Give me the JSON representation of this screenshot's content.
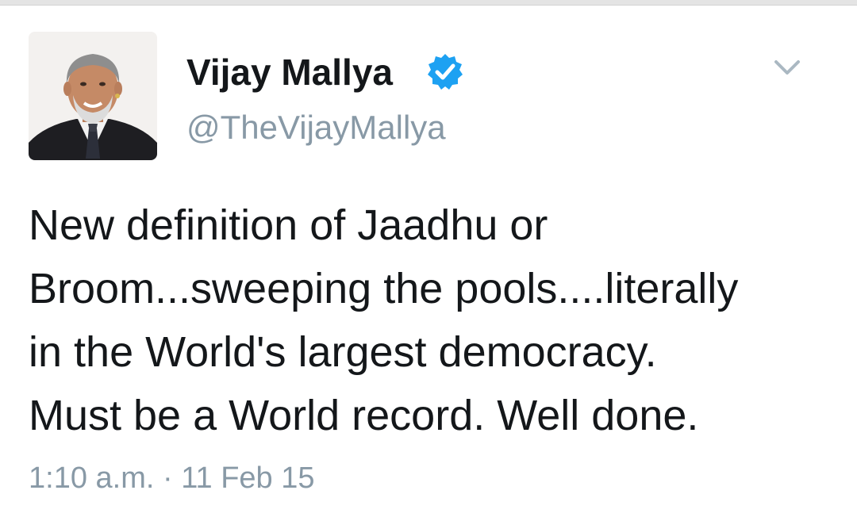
{
  "tweet": {
    "author": {
      "display_name": "Vijay Mallya",
      "handle": "@TheVijayMallya",
      "verified": true,
      "verified_badge_color": "#1da1f2",
      "avatar_icon": "profile-photo"
    },
    "text": "New definition of Jaadhu or\nBroom...sweeping the pools....literally\nin the World's largest democracy.\nMust be a World record. Well done.",
    "timestamp": "1:10 a.m. · 11 Feb 15",
    "menu_icon": "chevron-down-icon"
  },
  "colors": {
    "name_text": "#14171a",
    "secondary_text": "#8899a6",
    "background": "#ffffff"
  }
}
